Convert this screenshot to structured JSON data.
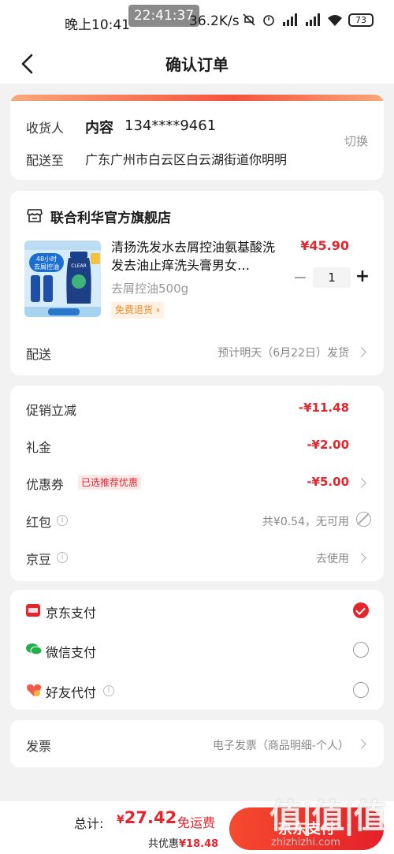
{
  "status_bar": {
    "time": "晚上10:41",
    "clock_overlay": "22:41:37",
    "speed": "36.2K/s",
    "signal_label": "HD",
    "battery": "73"
  },
  "header": {
    "title": "确认订单"
  },
  "address": {
    "receiver_label": "收货人",
    "name": "内容",
    "phone": "134****9461",
    "ship_to_label": "配送至",
    "detail": "广东广州市白云区白云湖街道你明明",
    "switch_label": "切换"
  },
  "store": {
    "name": "联合利华官方旗舰店",
    "product": {
      "title": "清扬洗发水去屑控油氨基酸洗发去油止痒洗头膏男女…",
      "spec": "去屑控油500g",
      "price": "¥45.90",
      "quantity": "1",
      "free_return": "免费退货",
      "image_texts": {
        "banner": "48小时",
        "subtitle": "去屑控油",
        "brand": "CLEAR"
      }
    },
    "shipping_label": "配送",
    "shipping_value": "预计明天（6月22日）发货"
  },
  "discounts": {
    "items": [
      {
        "label": "促销立减",
        "value": "-¥11.48"
      },
      {
        "label": "礼金",
        "value": "-¥2.00"
      },
      {
        "label": "优惠券",
        "tag": "已选推荐优惠",
        "value": "-¥5.00"
      },
      {
        "label": "红包",
        "value": "共¥0.54，无可用"
      },
      {
        "label": "京豆",
        "value": "去使用"
      }
    ]
  },
  "payment": {
    "options": [
      {
        "label": "京东支付",
        "icon": "jd-pay-icon",
        "selected": true
      },
      {
        "label": "微信支付",
        "icon": "wechat-pay-icon",
        "selected": false
      },
      {
        "label": "好友代付",
        "icon": "friend-pay-icon",
        "selected": false
      }
    ]
  },
  "invoice": {
    "label": "发票",
    "value": "电子发票（商品明细-个人）"
  },
  "bottom": {
    "total_label": "总计:",
    "currency": "¥",
    "total": "27.42",
    "free_shipping": "免运费",
    "saved_label": "共优惠",
    "saved_value": "¥18.48",
    "pay_button": "京东支付"
  },
  "watermark": {
    "text": "值|值|值",
    "url": "zhizhizhi.com"
  },
  "colors": {
    "accent": "#e3262e",
    "orange": "#f08a2c"
  }
}
